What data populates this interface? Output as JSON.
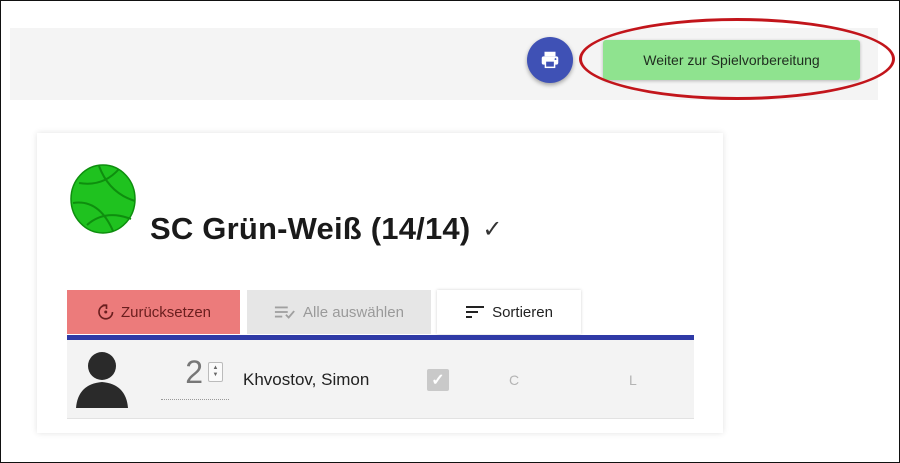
{
  "header": {
    "print_icon": "print-icon",
    "next_button_label": "Weiter zur Spielvorbereitung",
    "colors": {
      "print_button": "#3f51b5",
      "next_button": "#8fe38f",
      "annotation_ellipse": "#c2151b"
    }
  },
  "team": {
    "logo_icon": "volleyball-icon",
    "title": "SC Grün-Weiß (14/14)",
    "status_mark": "✓",
    "logo_color": "#1fc21f"
  },
  "tabs": {
    "reset": {
      "label": "Zurücksetzen",
      "icon": "reset-icon",
      "color": "#ec7b7b"
    },
    "select_all": {
      "label": "Alle auswählen",
      "icon": "playlist-check-icon",
      "disabled": true
    },
    "sort": {
      "label": "Sortieren",
      "icon": "sort-icon"
    }
  },
  "players": [
    {
      "number": "2",
      "name": "Khvostov, Simon",
      "selected": true,
      "captain_label": "C",
      "libero_label": "L"
    }
  ]
}
